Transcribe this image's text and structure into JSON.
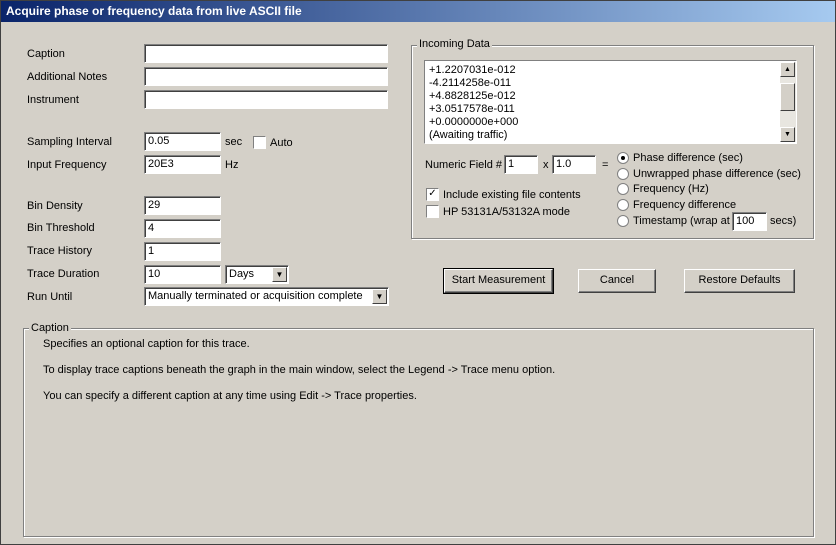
{
  "window": {
    "title": "Acquire phase or frequency data from live ASCII file"
  },
  "form": {
    "caption_label": "Caption",
    "caption_value": "",
    "notes_label": "Additional Notes",
    "notes_value": "",
    "instrument_label": "Instrument",
    "instrument_value": "",
    "sampling_label": "Sampling Interval",
    "sampling_value": "0.05",
    "sampling_unit": "sec",
    "auto_label": "Auto",
    "input_freq_label": "Input Frequency",
    "input_freq_value": "20E3",
    "input_freq_unit": "Hz",
    "bin_density_label": "Bin Density",
    "bin_density_value": "29",
    "bin_threshold_label": "Bin Threshold",
    "bin_threshold_value": "4",
    "trace_history_label": "Trace History",
    "trace_history_value": "1",
    "trace_duration_label": "Trace Duration",
    "trace_duration_value": "10",
    "trace_duration_unit": "Days",
    "run_until_label": "Run Until",
    "run_until_value": "Manually terminated or acquisition complete"
  },
  "incoming": {
    "title": "Incoming Data",
    "lines": [
      "+1.2207031e-012",
      "-4.2114258e-011",
      "+4.8828125e-012",
      "+3.0517578e-011",
      "+0.0000000e+000",
      "(Awaiting traffic)"
    ],
    "numeric_field_label": "Numeric Field #",
    "numeric_field_value": "1",
    "times_symbol": "x",
    "multiplier_value": "1.0",
    "equals_symbol": "=",
    "include_existing_label": "Include existing file contents",
    "hp_mode_label": "HP 53131A/53132A mode",
    "radio_phase": "Phase difference (sec)",
    "radio_unwrapped": "Unwrapped phase difference (sec)",
    "radio_frequency": "Frequency (Hz)",
    "radio_freq_diff": "Frequency difference",
    "radio_timestamp": "Timestamp (wrap at",
    "wrap_value": "100",
    "wrap_unit": "secs)"
  },
  "buttons": {
    "start": "Start Measurement",
    "cancel": "Cancel",
    "restore": "Restore Defaults"
  },
  "help": {
    "title": "Caption",
    "line1": "Specifies an optional caption for this trace.",
    "line2": "To display trace captions beneath the graph in the main window, select the Legend -> Trace menu option.",
    "line3": "You can specify a different caption at any time using Edit -> Trace properties."
  }
}
